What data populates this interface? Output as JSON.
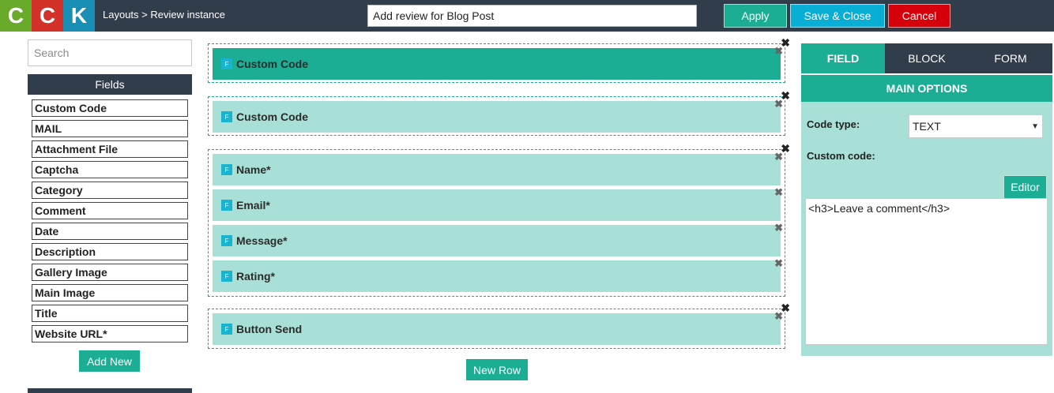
{
  "logo": {
    "letters": [
      "C",
      "C",
      "K"
    ],
    "colors": [
      "#6aaa2a",
      "#d3322b",
      "#1a8fb5"
    ]
  },
  "header": {
    "breadcrumb": "Layouts > Review instance",
    "title_value": "Add review for Blog Post",
    "apply_label": "Apply",
    "save_close_label": "Save & Close",
    "cancel_label": "Cancel"
  },
  "sidebar": {
    "search_placeholder": "Search",
    "fields_heading": "Fields",
    "fields": [
      "Custom Code",
      "MAIL",
      "Attachment File",
      "Captcha",
      "Category",
      "Comment",
      "Date",
      "Description",
      "Gallery Image",
      "Main Image",
      "Title",
      "Website URL*"
    ],
    "add_new_label": "Add New"
  },
  "layout": {
    "rows": [
      {
        "fields": [
          "Custom Code"
        ]
      },
      {
        "fields": [
          "Custom Code"
        ]
      },
      {
        "fields": [
          "Name*",
          "Email*",
          "Message*",
          "Rating*"
        ]
      },
      {
        "fields": [
          "Button Send"
        ]
      }
    ],
    "field_icon_letter": "F",
    "remove_glyph": "✖",
    "new_row_label": "New Row"
  },
  "panel": {
    "tabs": [
      "FIELD",
      "BLOCK",
      "FORM"
    ],
    "active_tab": "FIELD",
    "section_title": "MAIN OPTIONS",
    "code_type_label": "Code type:",
    "code_type_value": "TEXT",
    "custom_code_label": "Custom code:",
    "editor_label": "Editor",
    "custom_code_value": "<h3>Leave a comment</h3>"
  },
  "colors": {
    "topbar": "#313d4b",
    "accent": "#1bae94",
    "accent_light": "#a8e0d7",
    "save_close": "#08aed3",
    "cancel": "#d6000b",
    "field_icon": "#1ab3d0"
  }
}
